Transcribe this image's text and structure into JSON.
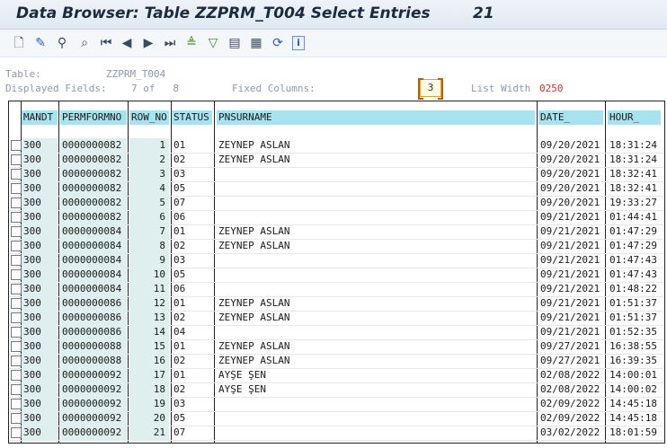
{
  "window": {
    "title": "Data Browser: Table ZZPRM_T004 Select Entries        21"
  },
  "toolbar": {
    "buttons": [
      {
        "name": "display-icon",
        "glyph": "🗋"
      },
      {
        "name": "change-icon",
        "glyph": "✎"
      },
      {
        "name": "check-table-icon",
        "glyph": "⚲"
      },
      {
        "name": "find-icon",
        "glyph": "⌕"
      },
      {
        "name": "first-page-icon",
        "glyph": "⏮"
      },
      {
        "name": "previous-page-icon",
        "glyph": "◀"
      },
      {
        "name": "next-page-icon",
        "glyph": "▶"
      },
      {
        "name": "last-page-icon",
        "glyph": "⏭"
      },
      {
        "name": "sort-ascending-icon",
        "glyph": "≜"
      },
      {
        "name": "filter-icon",
        "glyph": "▽"
      },
      {
        "name": "export-icon",
        "glyph": "▤"
      },
      {
        "name": "print-icon",
        "glyph": "▦"
      },
      {
        "name": "refresh-icon",
        "glyph": "⟳"
      },
      {
        "name": "info-icon",
        "glyph": "i"
      }
    ]
  },
  "info": {
    "table_label": "Table:",
    "table_value": "ZZPRM_T004",
    "displayed_label": "Displayed Fields:",
    "displayed_value": "7 of   8",
    "fixed_label": "Fixed Columns:",
    "fixed_value": "3",
    "width_label": "List Width",
    "width_value": "0250"
  },
  "columns": [
    "MANDT",
    "PERMFORMNO",
    "ROW_NO",
    "STATUS",
    "PNSURNAME",
    "DATE_",
    "HOUR_"
  ],
  "rows": [
    [
      "300",
      "0000000082",
      "1",
      "01",
      "ZEYNEP ASLAN",
      "09/20/2021",
      "18:31:24"
    ],
    [
      "300",
      "0000000082",
      "2",
      "02",
      "ZEYNEP ASLAN",
      "09/20/2021",
      "18:31:24"
    ],
    [
      "300",
      "0000000082",
      "3",
      "03",
      "",
      "09/20/2021",
      "18:32:41"
    ],
    [
      "300",
      "0000000082",
      "4",
      "05",
      "",
      "09/20/2021",
      "18:32:41"
    ],
    [
      "300",
      "0000000082",
      "5",
      "07",
      "",
      "09/20/2021",
      "19:33:27"
    ],
    [
      "300",
      "0000000082",
      "6",
      "06",
      "",
      "09/21/2021",
      "01:44:41"
    ],
    [
      "300",
      "0000000084",
      "7",
      "01",
      "ZEYNEP ASLAN",
      "09/21/2021",
      "01:47:29"
    ],
    [
      "300",
      "0000000084",
      "8",
      "02",
      "ZEYNEP ASLAN",
      "09/21/2021",
      "01:47:29"
    ],
    [
      "300",
      "0000000084",
      "9",
      "03",
      "",
      "09/21/2021",
      "01:47:43"
    ],
    [
      "300",
      "0000000084",
      "10",
      "05",
      "",
      "09/21/2021",
      "01:47:43"
    ],
    [
      "300",
      "0000000084",
      "11",
      "06",
      "",
      "09/21/2021",
      "01:48:22"
    ],
    [
      "300",
      "0000000086",
      "12",
      "01",
      "ZEYNEP ASLAN",
      "09/21/2021",
      "01:51:37"
    ],
    [
      "300",
      "0000000086",
      "13",
      "02",
      "ZEYNEP ASLAN",
      "09/21/2021",
      "01:51:37"
    ],
    [
      "300",
      "0000000086",
      "14",
      "04",
      "",
      "09/21/2021",
      "01:52:35"
    ],
    [
      "300",
      "0000000088",
      "15",
      "01",
      "ZEYNEP ASLAN",
      "09/27/2021",
      "16:38:55"
    ],
    [
      "300",
      "0000000088",
      "16",
      "02",
      "ZEYNEP ASLAN",
      "09/27/2021",
      "16:39:35"
    ],
    [
      "300",
      "0000000092",
      "17",
      "01",
      "AYŞE ŞEN",
      "02/08/2022",
      "14:00:01"
    ],
    [
      "300",
      "0000000092",
      "18",
      "02",
      "AYŞE ŞEN",
      "02/08/2022",
      "14:00:02"
    ],
    [
      "300",
      "0000000092",
      "19",
      "03",
      "",
      "02/09/2022",
      "14:45:18"
    ],
    [
      "300",
      "0000000092",
      "20",
      "05",
      "",
      "02/09/2022",
      "14:45:18"
    ],
    [
      "300",
      "0000000092",
      "21",
      "07",
      "",
      "03/02/2022",
      "18:01:59"
    ]
  ]
}
